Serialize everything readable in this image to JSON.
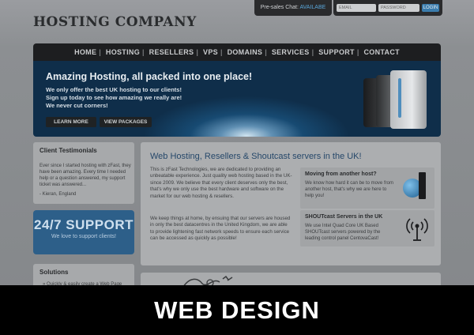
{
  "header": {
    "logo": "HOSTING COMPANY",
    "chat_label": "Pre-sales Chat:",
    "chat_status": "AVAILABE",
    "email_placeholder": "EMAIL",
    "password_placeholder": "PASSWORD",
    "login_label": "LOGIN"
  },
  "nav": [
    "HOME",
    "HOSTING",
    "RESELLERS",
    "VPS",
    "DOMAINS",
    "SERVICES",
    "SUPPORT",
    "CONTACT"
  ],
  "hero": {
    "title": "Amazing Hosting, all packed into one place!",
    "line1": "We only offer the best UK hosting to our clients!",
    "line2": "Sign up today to see how amazing we really are!",
    "line3": "We never cut corners!",
    "learn_more": "LEARN MORE",
    "view_packages": "VIEW PACKAGES"
  },
  "testimonials": {
    "title": "Client Testimonials",
    "quote": "Ever since I started hosting with zFast, they have been amazing. Every time I needed help or a question answered, my support ticket was answered...",
    "author": "- Kieran, England"
  },
  "support": {
    "headline": "24/7 SUPPORT",
    "sub": "We love to support clients!"
  },
  "solutions": {
    "title": "Solutions",
    "snippet": "» Quickly & easily create a Web Page"
  },
  "main": {
    "title": "Web Hosting, Resellers & Shoutcast servers in the UK!",
    "para1": "This is zFast Technologies, we are dedicated to providing an unbeatable experience. Just quality web hosting based in the UK- since 2009. We believe that every client deserves only the best, that's why we only use the best hardware and software on the market for our web hosting & resellers.",
    "para2": "We keep things at home, by ensuing that our servers are housed in only the best datacentres in the United Kingdom, we are able to provide lightening fast network speeds to ensure each service can be accessed as quickly as possible!"
  },
  "side1": {
    "title": "Moving from another host?",
    "body": "We know how hard it can be to move from another host, that's why we are here to help you!"
  },
  "side2": {
    "title": "SHOUTcast Servers in the UK",
    "body": "We use Intel Quad Core UK Based SHOUTcast servers powered by the leading control panel CentovaCast!"
  },
  "banner": "WEB DESIGN",
  "colors": {
    "accent": "#2d5f89",
    "nav_bg": "#1d1e20",
    "banner_bg": "#000000"
  }
}
